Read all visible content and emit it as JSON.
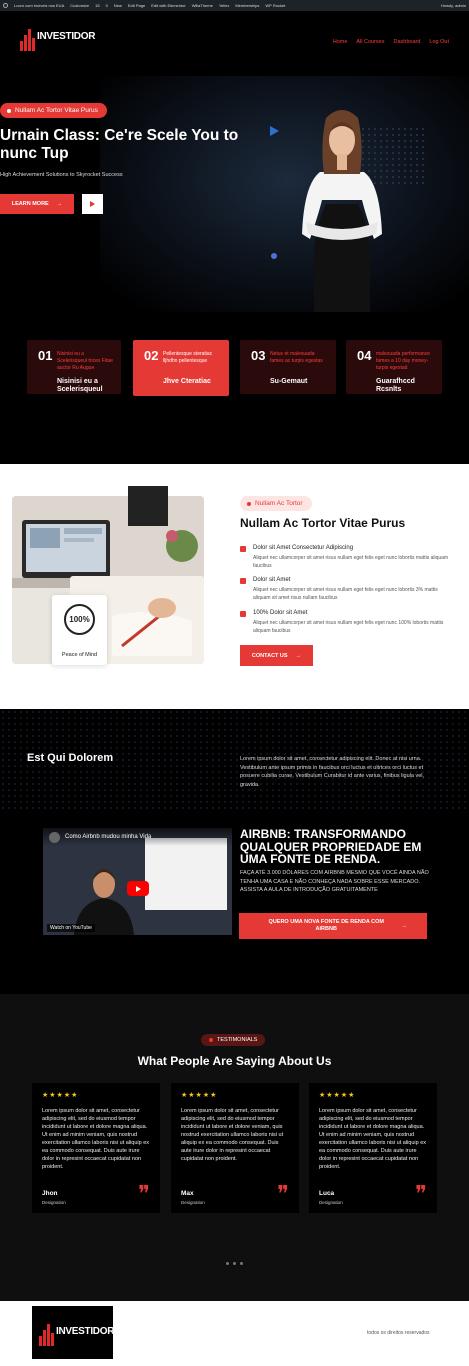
{
  "admin_bar": {
    "items": [
      "Lucro com imóveis nos EUA",
      "Customize",
      "15",
      "0",
      "New",
      "Edit Page",
      "Edit with Elementor",
      "WillaTheme",
      "Yellex",
      "Memberships",
      "WP Rocket"
    ],
    "howdy": "Howdy, admin"
  },
  "brand": {
    "logo_text": "INVESTIDOR",
    "accent": "#e53935"
  },
  "nav": {
    "items": [
      "Home",
      "All Courses",
      "Dashboard",
      "Log Out"
    ]
  },
  "hero": {
    "badge": "Nullam Ac Tortor Vitae Purus",
    "title": "Urnain Class: Ce're Scele You to nunc Tup",
    "subtitle": "High Achievement Solutions to Skyrocket Success",
    "cta": "LEARN MORE",
    "cta_icon": "arrow-right-icon",
    "play_icon": "play-icon"
  },
  "features": [
    {
      "num": "01",
      "small": "Nisinisi eu a Scelerisqueul trices Fitae auctor Ru Augue",
      "title": "Nisinisi eu a Scelerisqueul"
    },
    {
      "num": "02",
      "small": "Pellentesque steratiac lljhdhn pellentesque",
      "title": "Jhve Cteratiac"
    },
    {
      "num": "03",
      "small": "Netus et malesuada fames ac turpis egestas",
      "title": "Su-Gemaut"
    },
    {
      "num": "04",
      "small": "malesuada performance fames a 10 day money-turpis egestad",
      "title": "Guarafhccd Rcsnlts"
    }
  ],
  "about": {
    "badge": "Nullam Ac Tortor",
    "title": "Nullam Ac Tortor Vitae Purus",
    "stat_value": "100%",
    "stat_label": "Peace of Mind",
    "items": [
      {
        "heading": "Dolor sit Amet Consectetur Adipiscing",
        "text": "Aliquet nec ullamcorper sit amet risus nullam eget felis eget nunc lobortis mattis aliquam faucibus"
      },
      {
        "heading": "Dolor sit Amet",
        "text": "Aliquet nec ullamcorper sit amet risus nullam eget felis eget nunc lobortis 3% mattis aliquam sit amet risus nullam faucibus"
      },
      {
        "heading": "100% Dolor sit Amet",
        "text": "Aliquet nec ullamcorper sit amet risus nullam eget felis eget nunc 100% lobortis mattis aliquam faucibus"
      }
    ],
    "cta": "CONTACT US"
  },
  "section2": {
    "title": "Est Qui Dolorem",
    "paragraph": "Lorem ipsum dolor sit amet, consectetur adipiscing elit. Donec at nisi urna. Vestibulum ante ipsum primis in faucibus orci luctus et ultrices orci luctus et posuere cubilia curae, Vestibulum Curabitur id ante varius, finibus ligula vel, gravida.",
    "video_title": "Como Airbnb mudou minha Vida",
    "video_watch": "Watch on YouTube",
    "heading": "AIRBNB: TRANSFORMANDO QUALQUER PROPRIEDADE EM UMA FONTE DE RENDA.",
    "text": "FAÇA ATÉ 3.000 DÓLARES COM AIRBNB MESMO QUE VOCÊ AINDA NÃO TENHA UMA CASA E NÃO CONHEÇA NADA SOBRE ESSE MERCADO. ASSISTA A AULA DE INTRODUÇÃO GRATUITAMENTE",
    "cta": "QUERO UMA NOVA FONTE DE RENDA COM AIRBNB"
  },
  "testimonials": {
    "badge": "TESTIMONIALS",
    "title": "What People Are Saying About Us",
    "stars": "★★★★★",
    "items": [
      {
        "text": "Lorem ipsum dolor sit amet, consectetur adipiscing elit, sed do eiusmod tempor incididunt ut labore et dolore magna aliqua. Ut enim ad minim veniam, quis nostrud exercitation ullamco laboris nisi ut aliquip ex ea commodo consequat. Duis aute irure dolor in represint occaecat cupidatat non proident.",
        "name": "Jhon",
        "role": "Designation"
      },
      {
        "text": "Lorem ipsum dolor sit amet, consectetur adipiscing elit, sed do eiusmod tempor incididunt ut labore et dolore veniam, quis nostrud exercitation ullamco laboris nisi ut aliquip ex ea commodo consequat. Duis aute irure dolor in represint occaecat cupidatat non proident.",
        "name": "Max",
        "role": "Designation"
      },
      {
        "text": "Lorem ipsum dolor sit amet, consectetur adipiscing elit, sed do eiusmod tempor incididunt ut labore et dolore magna aliqua. Ut enim ad minim veniam, quis nostrud exercitation ullamco laboris nisi ut aliquip ex ea commodo consequat. Duis aute irure dolor in represint occaecat cupidatat non proident.",
        "name": "Luca",
        "role": "Designation"
      }
    ]
  },
  "footer": {
    "copyright": "todos os direitos reservados"
  }
}
